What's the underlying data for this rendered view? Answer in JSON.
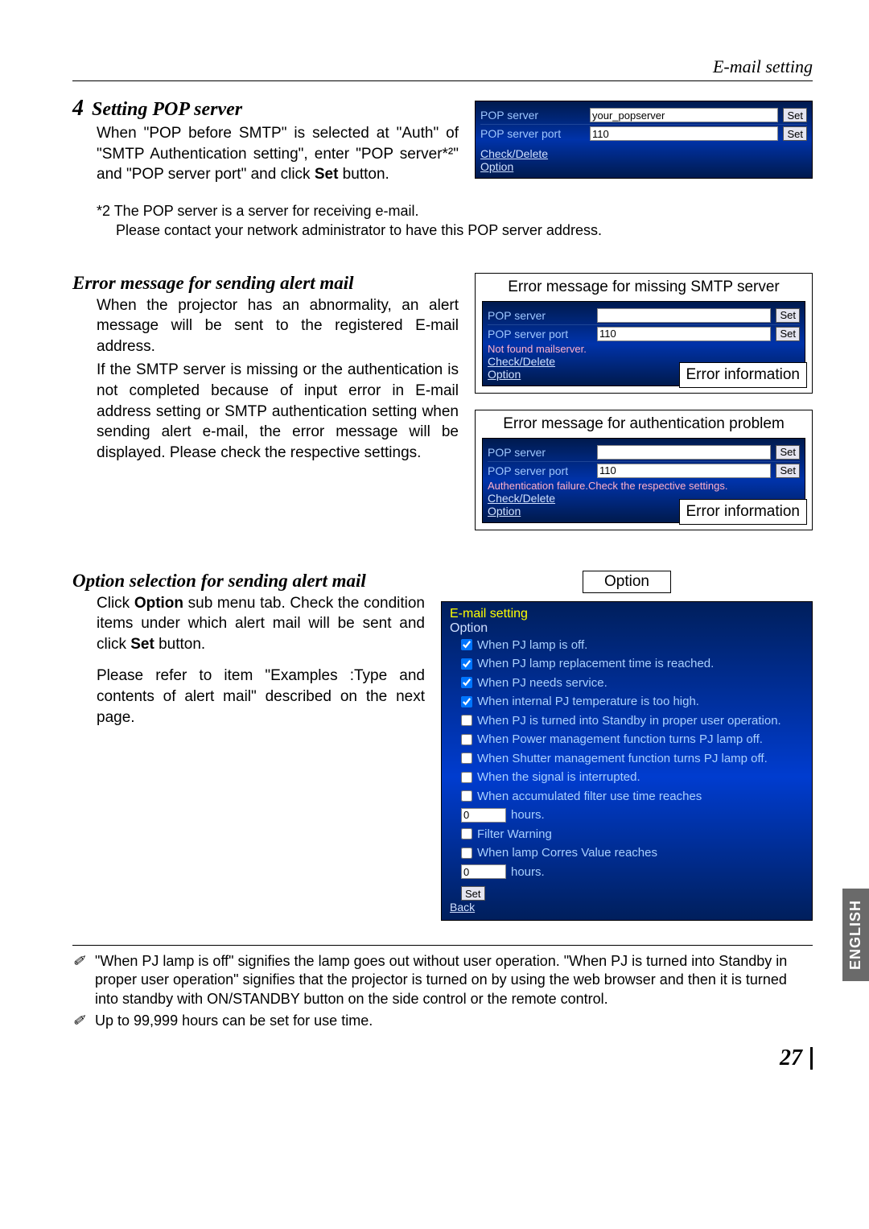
{
  "header": {
    "section_label": "E-mail setting"
  },
  "sec4": {
    "num": "4",
    "title": "Setting POP server",
    "body": "When \"POP before SMTP\" is selected at \"Auth\" of \"SMTP Authentication setting\", enter \"POP server*²\" and \"POP server port\" and click ",
    "body_bold": "Set",
    "body_tail": " button.",
    "footnote_l1": "*2 The POP server is a server for receiving e-mail.",
    "footnote_l2": "Please contact your network administrator to have this POP server address."
  },
  "shot1": {
    "row1_label": "POP server",
    "row1_value": "your_popserver",
    "row2_label": "POP server port",
    "row2_value": "110",
    "link1": "Check/Delete",
    "link2": "Option",
    "set": "Set"
  },
  "secErr": {
    "title": "Error message for sending alert mail",
    "p1": "When the projector has an abnormality, an alert message will be sent to the registered E-mail address.",
    "p2": "If the SMTP server is missing or the authentication is not completed because of input error in E-mail address setting or SMTP authentication setting when sending alert e-mail, the error message will be displayed. Please check the respective settings."
  },
  "errBox1": {
    "title": "Error message for missing SMTP server",
    "row1_label": "POP server",
    "row2_label": "POP server port",
    "row2_value": "110",
    "err": "Not found mailserver.",
    "link1": "Check/Delete",
    "link2": "Option",
    "set": "Set",
    "info": "Error information"
  },
  "errBox2": {
    "title": "Error message for authentication problem",
    "row1_label": "POP server",
    "row2_label": "POP server port",
    "row2_value": "110",
    "err": "Authentication failure.Check the respective settings.",
    "link1": "Check/Delete",
    "link2": "Option",
    "set": "Set",
    "info": "Error information"
  },
  "secOpt": {
    "title": "Option selection for sending alert mail",
    "p1a": "Click ",
    "p1_bold1": "Option",
    "p1b": " sub menu tab. Check the condition items under which alert mail will be sent and click ",
    "p1_bold2": "Set",
    "p1c": " button.",
    "p2": "Please refer to item \"Examples :Type and contents of alert mail\" described on the next page.",
    "callout": "Option"
  },
  "optionPanel": {
    "head1": "E-mail setting",
    "head2": "Option",
    "items": [
      "When PJ lamp is off.",
      "When PJ lamp replacement time is reached.",
      "When PJ needs service.",
      "When internal PJ temperature is too high.",
      "When PJ is turned into Standby in proper user operation.",
      "When Power management function turns PJ lamp off.",
      "When Shutter management function turns PJ lamp off.",
      "When the signal is interrupted.",
      "When accumulated filter use time reaches"
    ],
    "hours1_value": "0",
    "hours_label": "hours.",
    "filter_warning": "Filter Warning",
    "lamp_corres": "When lamp Corres Value reaches",
    "hours2_value": "0",
    "set": "Set",
    "back": "Back"
  },
  "notes": {
    "n1": "\"When PJ lamp is off\" signifies the lamp goes out without user operation. \"When PJ is turned into Standby  in proper user operation\" signifies that the projector is turned on by using the web browser and then it is turned into standby with ON/STANDBY button on the side control or the remote control.",
    "n2": "Up to 99,999 hours can be set for use time."
  },
  "footer": {
    "lang": "ENGLISH",
    "page_num": "27"
  },
  "checked": [
    true,
    true,
    true,
    true,
    false,
    false,
    false,
    false,
    false
  ]
}
